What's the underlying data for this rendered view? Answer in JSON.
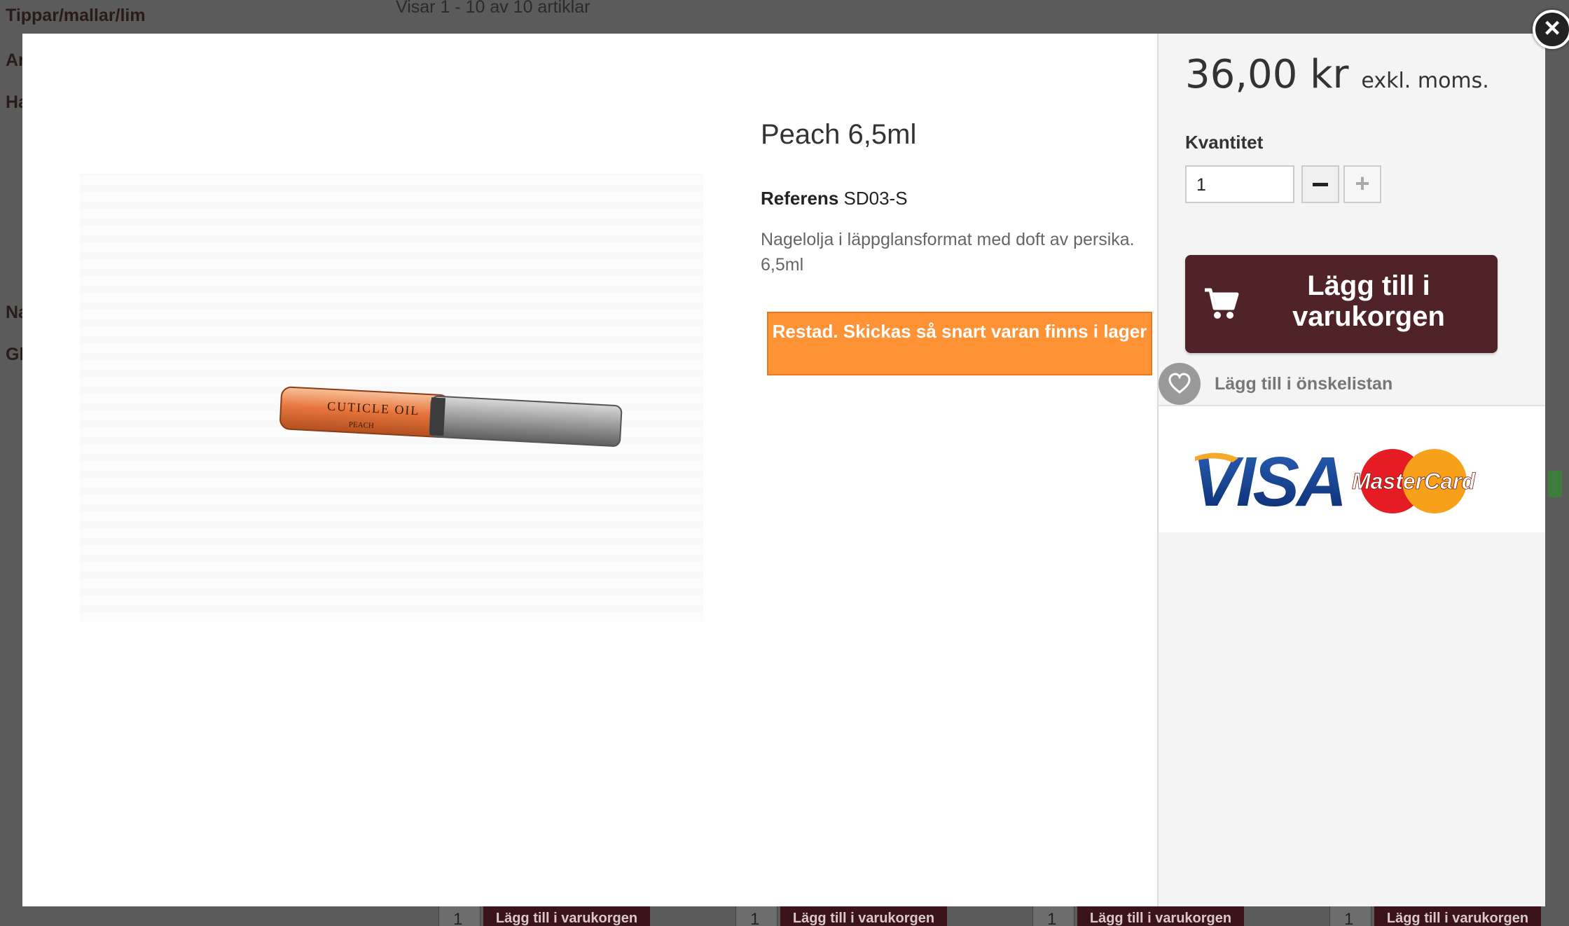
{
  "background": {
    "categories": [
      "Tippar/mallar/lim",
      "Ar",
      "Ha",
      "Na",
      "Gl"
    ],
    "count_text": "Visar 1 - 10 av 10 artiklar",
    "rows": [
      {
        "qty": "1",
        "button": "Lägg till i varukorgen"
      },
      {
        "qty": "1",
        "button": "Lägg till i varukorgen"
      },
      {
        "qty": "1",
        "button": "Lägg till i varukorgen"
      },
      {
        "qty": "1",
        "button": "Lägg till i varukorgen"
      }
    ]
  },
  "modal": {
    "close_icon": "close-icon",
    "product": {
      "image_text": "CUTICLE OIL",
      "image_sub": "PEACH",
      "title": "Peach 6,5ml",
      "reference_label": "Referens",
      "reference_value": "SD03-S",
      "description": "Nagelolja i läppglansformat med doft av persika. 6,5ml",
      "stock_message": "Restad. Skickas så snart varan finns i lager"
    },
    "buy": {
      "price": "36,00 kr",
      "price_suffix": "exkl. moms.",
      "quantity_label": "Kvantitet",
      "quantity_value": "1",
      "minus_icon": "minus-icon",
      "plus_icon": "plus-icon",
      "plus_symbol": "+",
      "add_to_cart": "Lägg till i varukorgen",
      "cart_icon": "cart-icon",
      "wishlist": "Lägg till i önskelistan",
      "heart_icon": "heart-icon",
      "payment_logo_visa": "VISA",
      "payment_logo_mc": "MasterCard"
    }
  },
  "colors": {
    "overlay": "#5b5b5b",
    "cart_button": "#4f2327",
    "stock_box": "#ff9234"
  }
}
